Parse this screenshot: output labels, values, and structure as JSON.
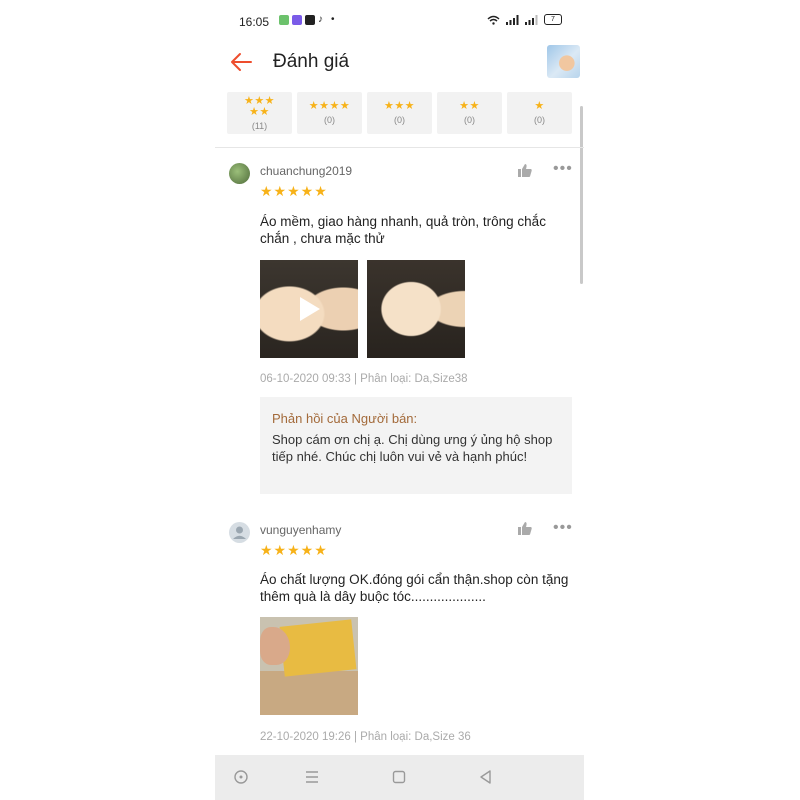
{
  "status_bar": {
    "time": "16:05",
    "battery": "7",
    "dot": "•"
  },
  "header": {
    "title": "Đánh giá"
  },
  "filters": [
    {
      "stars": "★★★\n★★",
      "count": "(11)"
    },
    {
      "stars": "★★★★",
      "count": "(0)"
    },
    {
      "stars": "★★★",
      "count": "(0)"
    },
    {
      "stars": "★★",
      "count": "(0)"
    },
    {
      "stars": "★",
      "count": "(0)"
    }
  ],
  "reviews": [
    {
      "username": "chuanchung2019",
      "stars": "★★★★★",
      "text": "Áo mềm, giao hàng nhanh, quả tròn,  trông chắc chắn , chưa mặc thử",
      "meta": "06-10-2020 09:33 | Phân loại: Da,Size38",
      "seller_reply_label": "Phản hồi của Người bán:",
      "seller_reply_text": "Shop cám ơn chị ạ. Chị dùng ưng ý ủng hộ shop tiếp nhé. Chúc chị luôn vui vẻ và hạnh phúc!"
    },
    {
      "username": "vunguyenhamy",
      "stars": "★★★★★",
      "text": "Áo chất lượng OK.đóng gói cẩn thận.shop còn tặng thêm quà là dây buộc tóc....................",
      "meta": "22-10-2020 19:26 | Phân loại: Da,Size 36"
    }
  ],
  "colors": {
    "accent": "#ee4d2d",
    "star": "#f7b219",
    "reply_label": "#a36a3a"
  }
}
